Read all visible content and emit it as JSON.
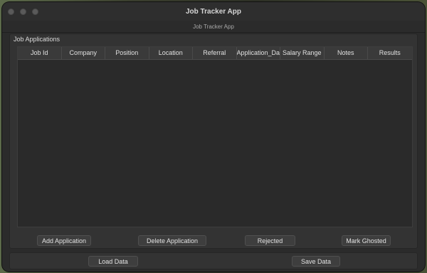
{
  "window": {
    "title": "Job Tracker App",
    "subtitle": "Job Tracker App"
  },
  "group": {
    "title": "Job Applications"
  },
  "table": {
    "columns": [
      "Job Id",
      "Company",
      "Position",
      "Location",
      "Referral",
      "Application_Date",
      "Salary Range",
      "Notes",
      "Results"
    ],
    "rows": []
  },
  "actions": {
    "add_application": "Add Application",
    "delete_application": "Delete Application",
    "rejected": "Rejected",
    "mark_ghosted": "Mark Ghosted"
  },
  "footer": {
    "load_data": "Load Data",
    "save_data": "Save Data"
  }
}
